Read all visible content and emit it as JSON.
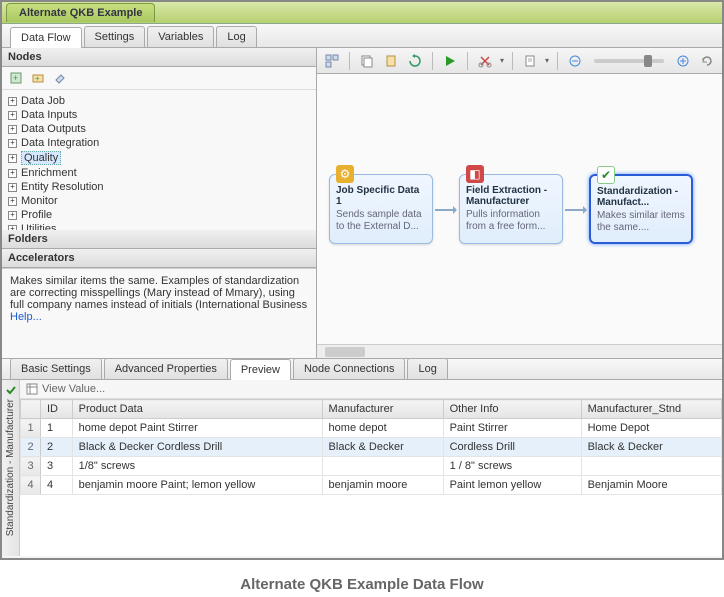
{
  "window_title": "Alternate QKB Example",
  "main_tabs": [
    "Data Flow",
    "Settings",
    "Variables",
    "Log"
  ],
  "main_tab_active": 0,
  "left": {
    "nodes_header": "Nodes",
    "tree": [
      {
        "label": "Data Job"
      },
      {
        "label": "Data Inputs"
      },
      {
        "label": "Data Outputs"
      },
      {
        "label": "Data Integration"
      },
      {
        "label": "Quality",
        "selected": true
      },
      {
        "label": "Enrichment"
      },
      {
        "label": "Entity Resolution"
      },
      {
        "label": "Monitor"
      },
      {
        "label": "Profile"
      },
      {
        "label": "Utilities"
      }
    ],
    "folders_header": "Folders",
    "accelerators_header": "Accelerators",
    "description": "Makes similar items the same. Examples of standardization are correcting misspellings (Mary instead of Mmary), using full company names instead of initials (International Business",
    "help": "Help..."
  },
  "canvas": {
    "nodes": [
      {
        "title": "Job Specific Data 1",
        "desc": "Sends sample data to the External D...",
        "icon_color": "#e8b030"
      },
      {
        "title": "Field Extraction - Manufacturer",
        "desc": "Pulls information from a free form...",
        "icon_color": "#d04848"
      },
      {
        "title": "Standardization - Manufact...",
        "desc": "Makes similar items the same....",
        "icon_color": "#50a850",
        "selected": true,
        "check": true
      }
    ]
  },
  "bottom_tabs": [
    "Basic Settings",
    "Advanced Properties",
    "Preview",
    "Node Connections",
    "Log"
  ],
  "bottom_tab_active": 2,
  "side_label": "Standardization - Manufacturer",
  "view_value": "View Value...",
  "table": {
    "columns": [
      "ID",
      "Product Data",
      "Manufacturer",
      "Other Info",
      "Manufacturer_Stnd"
    ],
    "rows": [
      {
        "id": "1",
        "pd": "home depot Paint Stirrer",
        "mf": "home depot",
        "oi": "Paint Stirrer",
        "ms": "Home Depot"
      },
      {
        "id": "2",
        "pd": "Black & Decker Cordless Drill",
        "mf": "Black & Decker",
        "oi": "Cordless Drill",
        "ms": "Black & Decker",
        "selected": true
      },
      {
        "id": "3",
        "pd": "1/8\" screws",
        "mf": "",
        "oi": "1 / 8\" screws",
        "ms": ""
      },
      {
        "id": "4",
        "pd": "benjamin moore Paint; lemon yellow",
        "mf": "benjamin moore",
        "oi": "Paint lemon yellow",
        "ms": "Benjamin Moore"
      }
    ]
  },
  "caption": "Alternate QKB Example Data Flow"
}
